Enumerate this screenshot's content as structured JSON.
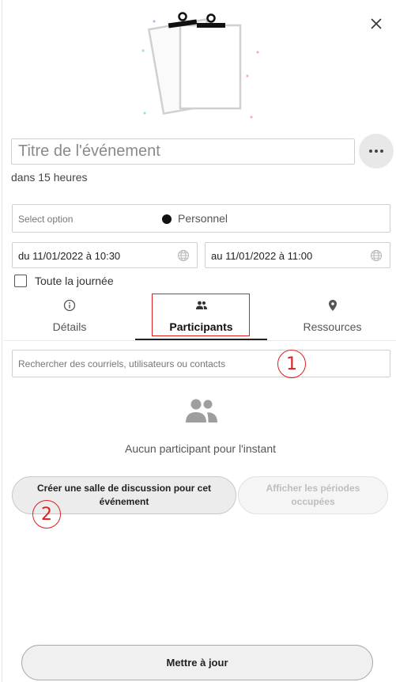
{
  "header": {
    "close_icon": "close-icon",
    "illustration": "clipboard-illustration"
  },
  "event": {
    "title_placeholder": "Titre de l'événement",
    "more_icon": "more-horizontal-icon",
    "relative_time": "dans 15 heures"
  },
  "calendar_select": {
    "placeholder": "Select option",
    "value": "Personnel",
    "color": "#111111"
  },
  "dates": {
    "start": "du 11/01/2022 à 10:30",
    "end": "au 11/01/2022 à 11:00",
    "timezone_icon": "globe-icon"
  },
  "all_day": {
    "label": "Toute la journée",
    "checked": false
  },
  "tabs": [
    {
      "label": "Détails",
      "icon": "info-icon",
      "active": false
    },
    {
      "label": "Participants",
      "icon": "people-icon",
      "active": true
    },
    {
      "label": "Ressources",
      "icon": "location-pin-icon",
      "active": false
    }
  ],
  "participants": {
    "search_placeholder": "Rechercher des courriels, utilisateurs ou contacts",
    "empty_icon": "people-icon",
    "empty_text": "Aucun participant pour l'instant",
    "create_chat_label": "Créer une salle de discussion pour cet événement",
    "busy_periods_label": "Afficher les périodes occupées"
  },
  "footer": {
    "update_label": "Mettre à jour"
  },
  "annotations": {
    "callout_1": "1",
    "callout_2": "2",
    "color": "#e02020"
  }
}
